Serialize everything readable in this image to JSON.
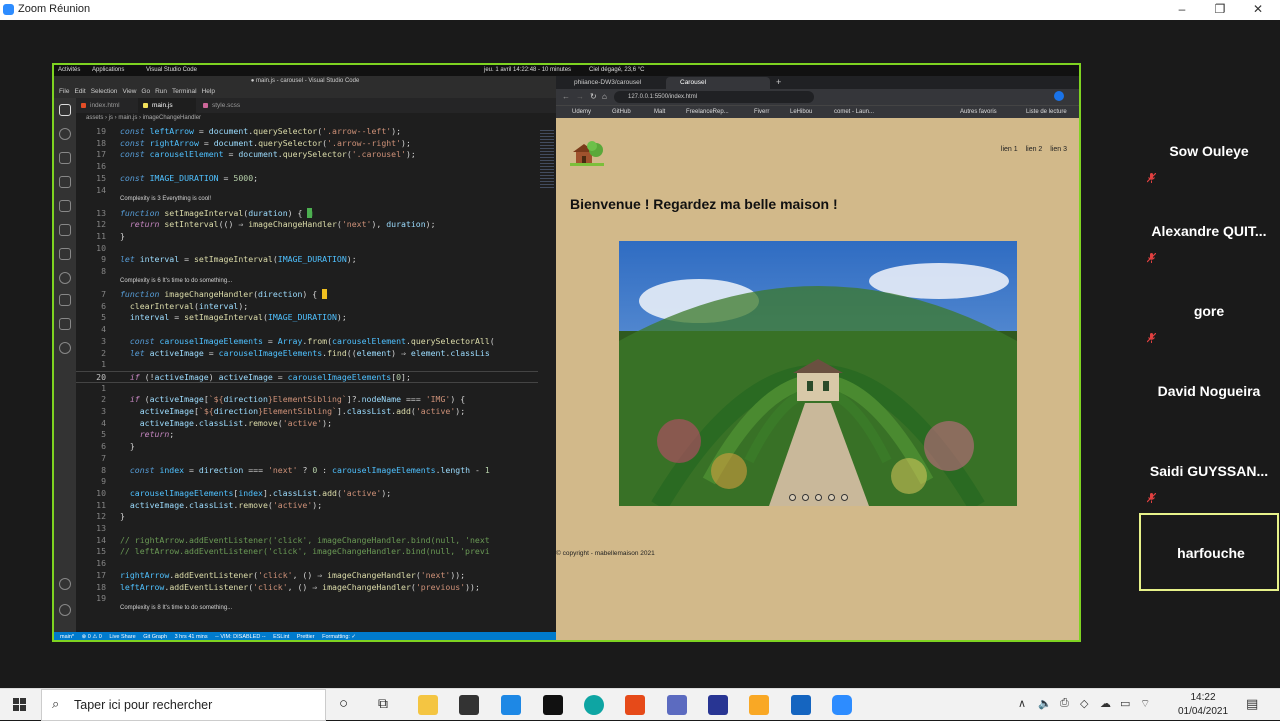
{
  "zoom": {
    "title": "Zoom Réunion",
    "participants": [
      {
        "name": "Sow Ouleye",
        "muted": true
      },
      {
        "name": "Alexandre  QUIT...",
        "muted": true
      },
      {
        "name": "gore",
        "muted": true
      },
      {
        "name": "David Nogueira",
        "muted": false
      },
      {
        "name": "Saidi  GUYSSAN...",
        "muted": true
      },
      {
        "name": "harfouche",
        "muted": false,
        "active": true
      }
    ]
  },
  "gnome_bar": {
    "activities": "Activités",
    "applications": "Applications",
    "app": "Visual Studio Code",
    "datetime": "jeu. 1 avril  14:22:48 - 10 minutes",
    "weather": "Ciel dégagé, 23,6 °C"
  },
  "vscode": {
    "title": "● main.js - carousel - Visual Studio Code",
    "menu": [
      "File",
      "Edit",
      "Selection",
      "View",
      "Go",
      "Run",
      "Terminal",
      "Help"
    ],
    "tabs": [
      {
        "label": "index.html",
        "color": "#e44d26",
        "active": false
      },
      {
        "label": "main.js",
        "color": "#f1e05a",
        "active": true
      },
      {
        "label": "style.scss",
        "color": "#cd6799",
        "active": false
      }
    ],
    "breadcrumb": "assets  ›  js  ›  main.js  ›  imageChangeHandler",
    "status": {
      "branch": "main*",
      "problems": "⊗ 0 ⚠ 0",
      "liveshare": "Live Share",
      "gitgraph": "Git Graph",
      "time": "3 hrs 41 mins",
      "vim": "-- VIM: DISABLED --",
      "eslint": "ESLint",
      "prettier": "Prettier",
      "formatting": "Formatting: ✓"
    },
    "lens": {
      "c1": "Complexity is 3 Everything is cool!",
      "c2": "Complexity is 6 It's time to do something...",
      "c3": "Complexity is 8 It's time to do something..."
    }
  },
  "browser": {
    "tabs": [
      "phiiance-DW3/carousel",
      "Carousel"
    ],
    "url": "127.0.0.1:5500/index.html",
    "bookmarks": [
      "Udemy",
      "GitHub",
      "Malt",
      "FreelanceRep...",
      "Fiverr",
      "LeHibou",
      "comet - Laun...",
      "Autres favoris",
      "Liste de lecture"
    ],
    "nav_links": [
      "lien 1",
      "lien 2",
      "lien 3"
    ],
    "heading": "Bienvenue ! Regardez ma belle maison !",
    "carousel_dots": 5,
    "copyright": "© copyright - mabellemaison 2021"
  },
  "taskbar": {
    "search_placeholder": "Taper ici pour rechercher",
    "time": "14:22",
    "date": "01/04/2021"
  }
}
